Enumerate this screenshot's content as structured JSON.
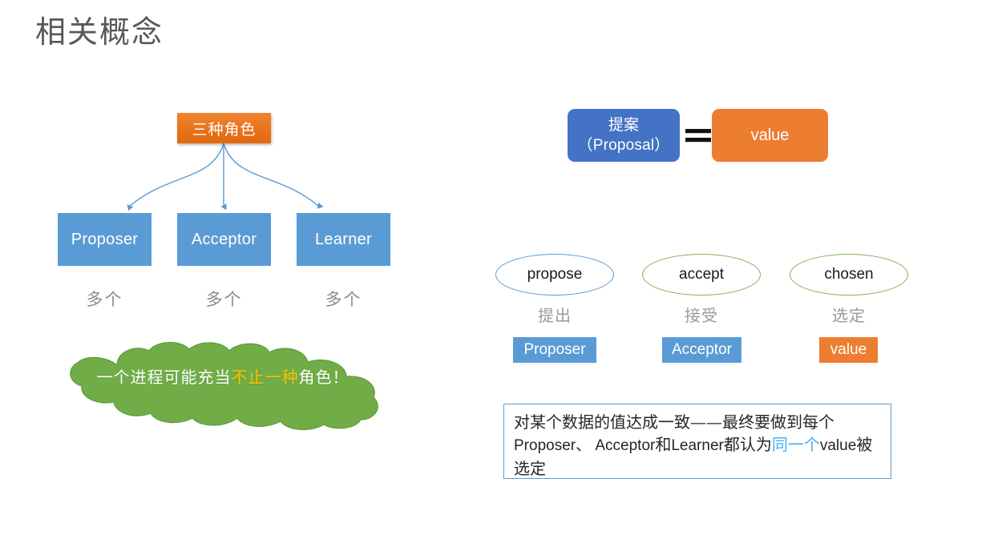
{
  "slide": {
    "title": "相关概念",
    "colors": {
      "orange": "#ED7D31",
      "orange_gradient": "#F0852F",
      "blue": "#5B9BD5",
      "blue_dark": "#4472C4",
      "green": "#70AD47",
      "green_border": "#7FB25A",
      "gray_text": "#8C8C8C",
      "highlight_yellow": "#FFC000",
      "highlight_cyan": "#3AB0F3",
      "title_gray": "#585858"
    }
  },
  "left": {
    "root_box": {
      "label": "三种角色"
    },
    "roles": [
      {
        "name": "Proposer",
        "count": "多个"
      },
      {
        "name": "Acceptor",
        "count": "多个"
      },
      {
        "name": "Learner",
        "count": "多个"
      }
    ],
    "cloud": {
      "line1_plain": "一个进程可能充当",
      "line1_highlight": "不止",
      "line2_highlight": "一种",
      "line2_plain": "角色！"
    }
  },
  "right": {
    "equation": {
      "left_box_line1": "提案",
      "left_box_line2": "（Proposal）",
      "operator": "=",
      "right_box": "value"
    },
    "stages": [
      {
        "term": "propose",
        "cn": "提出",
        "chip": "Proposer",
        "ellipse_color": "#5B9BD5",
        "chip_color": "#5B9BD5"
      },
      {
        "term": "accept",
        "cn": "接受",
        "chip": "Acceptor",
        "ellipse_color": "#7FB25A",
        "chip_color": "#5B9BD5"
      },
      {
        "term": "chosen",
        "cn": "选定",
        "chip": "value",
        "ellipse_color": "#7FB25A",
        "chip_color": "#ED7D31"
      }
    ],
    "definition": {
      "part1": "对某个数据的值达成一致——最终要做到每个",
      "part2_en": "Proposer、 Acceptor",
      "part3": "和",
      "part4_en": "Learner",
      "part5": "都认为",
      "highlight": "同一个",
      "part6_en": "value",
      "part7": "被选定"
    }
  }
}
